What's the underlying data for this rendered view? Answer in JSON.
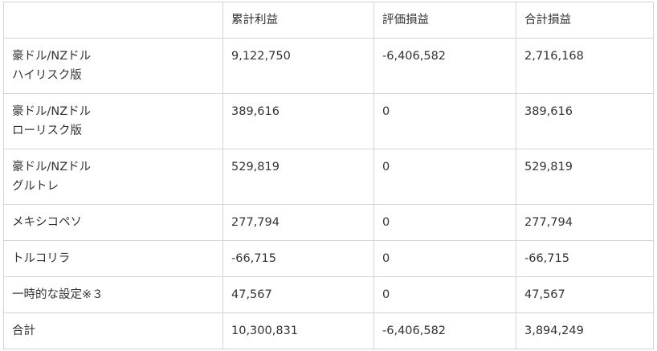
{
  "table": {
    "headers": [
      "",
      "累計利益",
      "評価損益",
      "合計損益"
    ],
    "rows": [
      {
        "name_lines": [
          "豪ドル/NZドル",
          "ハイリスク版"
        ],
        "cumulative": "9,122,750",
        "unrealized": "-6,406,582",
        "total": "2,716,168"
      },
      {
        "name_lines": [
          "豪ドル/NZドル",
          "ローリスク版"
        ],
        "cumulative": "389,616",
        "unrealized": "0",
        "total": "389,616"
      },
      {
        "name_lines": [
          "豪ドル/NZドル",
          "グルトレ"
        ],
        "cumulative": "529,819",
        "unrealized": "0",
        "total": "529,819"
      },
      {
        "name_lines": [
          "メキシコペソ"
        ],
        "cumulative": "277,794",
        "unrealized": "0",
        "total": "277,794"
      },
      {
        "name_lines": [
          "トルコリラ"
        ],
        "cumulative": "-66,715",
        "unrealized": "0",
        "total": "-66,715"
      },
      {
        "name_lines": [
          "一時的な設定※３"
        ],
        "cumulative": "47,567",
        "unrealized": "0",
        "total": "47,567"
      },
      {
        "name_lines": [
          "合計"
        ],
        "cumulative": "10,300,831",
        "unrealized": "-6,406,582",
        "total": "3,894,249"
      }
    ]
  }
}
